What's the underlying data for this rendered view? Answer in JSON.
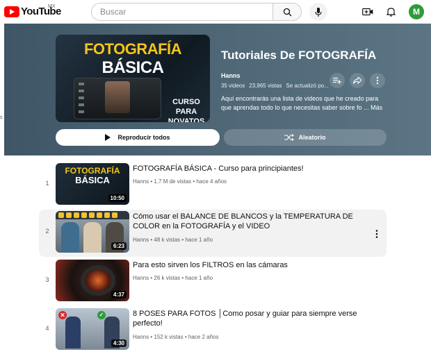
{
  "header_bar": {
    "logo_text": "YouTube",
    "country": "MX",
    "search_placeholder": "Buscar",
    "avatar_initial": "M"
  },
  "playlist": {
    "thumb_title_line1": "FOTOGRAFÍA",
    "thumb_title_line2": "BÁSICA",
    "thumb_caption": "CURSO PARA NOVATOS",
    "title": "Tutoriales De FOTOGRAFÍA",
    "owner": "Hanns",
    "video_count": "35 videos",
    "views": "23,965 vistas",
    "updated": "Se actualizó po...",
    "description": "Aquí encontrarás una lista de videos que he creado para que aprendas todo lo que necesitas saber sobre fo ... Más",
    "play_all_label": "Reproducir todos",
    "shuffle_label": "Aleatorio"
  },
  "videos": [
    {
      "index": "1",
      "title": "FOTOGRAFÍA BÁSICA - Curso para principiantes!",
      "channel": "Hanns",
      "views": "1.7 M de vistas",
      "age": "hace 4 años",
      "duration": "10:50",
      "thumb_line1": "FOTOGRAFÍA",
      "thumb_line2": "BÁSICA"
    },
    {
      "index": "2",
      "title": "Cómo usar el BALANCE DE BLANCOS y la TEMPERATURA DE COLOR en la FOTOGRAFÍA y el VIDEO",
      "channel": "Hanns",
      "views": "48 k vistas",
      "age": "hace 1 año",
      "duration": "6:23"
    },
    {
      "index": "3",
      "title": "Para esto sirven los FILTROS en las cámaras",
      "channel": "Hanns",
      "views": "26 k vistas",
      "age": "hace 1 año",
      "duration": "4:37"
    },
    {
      "index": "4",
      "title": "8 POSES PARA FOTOS │Como posar y guiar para siempre verse perfecto!",
      "channel": "Hanns",
      "views": "152 k vistas",
      "age": "hace 2 años",
      "duration": "4:30"
    }
  ],
  "colors": {
    "brand_red": "#ff0000",
    "header_bg": "#4d6575",
    "avatar_bg": "#2e9b3a",
    "hover_row": "#f2f2f2"
  }
}
